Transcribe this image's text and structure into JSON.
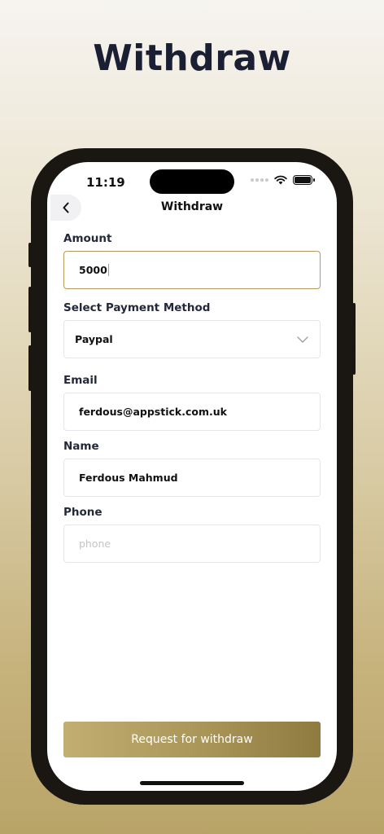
{
  "hero_title": "Withdraw",
  "status_bar": {
    "time": "11:19"
  },
  "nav": {
    "title": "Withdraw",
    "back_icon": "chevron-left-icon"
  },
  "form": {
    "amount": {
      "label": "Amount",
      "value": "5000"
    },
    "payment_method": {
      "label": "Select Payment Method",
      "selected": "Paypal",
      "icon": "chevron-down-icon"
    },
    "email": {
      "label": "Email",
      "value": "ferdous@appstick.com.uk"
    },
    "name": {
      "label": "Name",
      "value": "Ferdous Mahmud"
    },
    "phone": {
      "label": "Phone",
      "value": "",
      "placeholder": "phone"
    }
  },
  "submit_label": "Request for withdraw",
  "colors": {
    "accent": "#b49a5c",
    "title": "#1b1f33",
    "button_start": "#c2ae71",
    "button_end": "#8f7a40"
  }
}
